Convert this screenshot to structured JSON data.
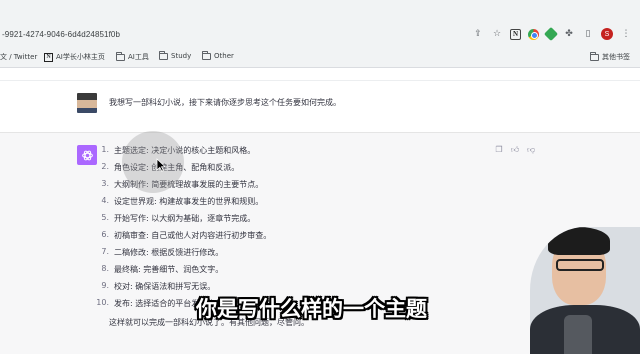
{
  "browser": {
    "url_fragment": "-9921-4274-9046-6d4d24851f0b",
    "profile_initial": "S",
    "bookmarks": [
      {
        "label": "文 / Twitter",
        "icon": "twitter-icon"
      },
      {
        "label": "AI学长小林主页",
        "icon": "notion-icon"
      },
      {
        "label": "AI工具",
        "icon": "folder-icon"
      },
      {
        "label": "Study",
        "icon": "folder-icon"
      },
      {
        "label": "Other",
        "icon": "folder-icon"
      }
    ],
    "other_bookmarks": "其他书签"
  },
  "chat": {
    "user_message": "我想写一部科幻小说，接下来请你逐步思考这个任务要如何完成。",
    "assistant_steps": [
      {
        "num": "1.",
        "text": "主题选定: 决定小说的核心主题和风格。"
      },
      {
        "num": "2.",
        "text": "角色设定: 创建主角、配角和反派。"
      },
      {
        "num": "3.",
        "text": "大纲制作: 简要梳理故事发展的主要节点。"
      },
      {
        "num": "4.",
        "text": "设定世界观: 构建故事发生的世界和规则。"
      },
      {
        "num": "5.",
        "text": "开始写作: 以大纲为基础，逐章节完成。"
      },
      {
        "num": "6.",
        "text": "初稿审查: 自己或他人对内容进行初步审查。"
      },
      {
        "num": "7.",
        "text": "二稿修改: 根据反馈进行修改。"
      },
      {
        "num": "8.",
        "text": "最终稿: 完善细节、润色文字。"
      },
      {
        "num": "9.",
        "text": "校对: 确保语法和拼写无误。"
      },
      {
        "num": "10.",
        "text": "发布: 选择适合的平台发布作品。"
      }
    ],
    "assistant_outro": "这样就可以完成一部科幻小说了。有其他问题，尽管问。"
  },
  "overlay": {
    "subtitle": "你是写什么样的一个主题"
  },
  "colors": {
    "gpt_logo": "#ab68ff",
    "assistant_bg": "#f7f7f8",
    "chrome_bg": "#f1f3f4"
  }
}
